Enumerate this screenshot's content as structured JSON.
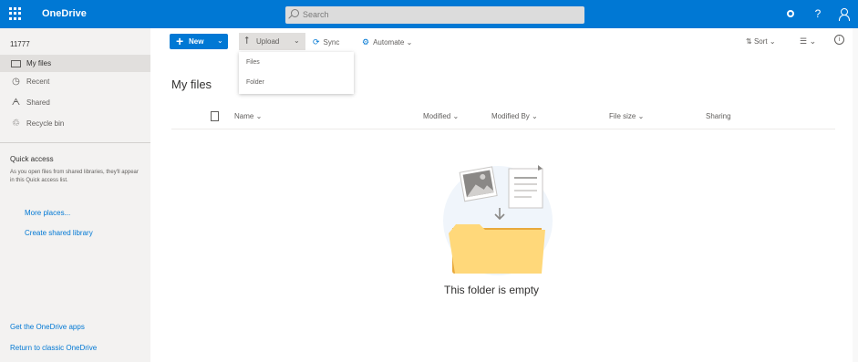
{
  "app": {
    "title": "OneDrive",
    "account_name": "11777"
  },
  "search": {
    "placeholder": "Search"
  },
  "sidebar": {
    "items": [
      {
        "label": "My files",
        "icon": "folder-icon",
        "active": true
      },
      {
        "label": "Recent",
        "icon": "clock-icon",
        "active": false
      },
      {
        "label": "Shared",
        "icon": "share-icon",
        "active": false
      },
      {
        "label": "Recycle bin",
        "icon": "recycle-bin-icon",
        "active": false
      }
    ],
    "quick_access": {
      "title": "Quick access",
      "description": "As you open files from shared libraries, they'll appear in this Quick access list.",
      "more_places": "More places...",
      "create_library": "Create shared library"
    },
    "footer": {
      "get_apps": "Get the OneDrive apps",
      "return_classic": "Return to classic OneDrive"
    }
  },
  "toolbar": {
    "new_label": "New",
    "upload_label": "Upload",
    "sync_label": "Sync",
    "automate_label": "Automate",
    "sort_label": "Sort"
  },
  "upload_menu": {
    "options": [
      "Files",
      "Folder"
    ]
  },
  "main": {
    "title": "My files",
    "columns": [
      "Name",
      "Modified",
      "Modified By",
      "File size",
      "Sharing"
    ],
    "empty_message": "This folder is empty"
  },
  "colors": {
    "brand": "#0078d4",
    "sidebar_bg": "#f3f2f1",
    "active_item_bg": "#e1dfdd"
  }
}
